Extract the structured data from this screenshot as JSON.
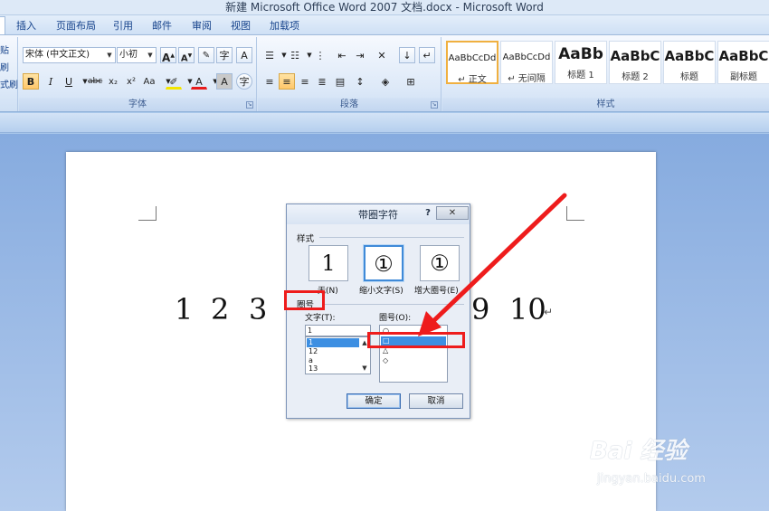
{
  "window": {
    "title": "新建 Microsoft Office Word 2007 文档.docx - Microsoft Word"
  },
  "tabs": [
    "插入",
    "页面布局",
    "引用",
    "邮件",
    "审阅",
    "视图",
    "加载项"
  ],
  "ribbon": {
    "font": {
      "name": "宋体 (中文正文)",
      "size": "小初",
      "group_label": "字体",
      "bold": "B",
      "italic": "I",
      "underline": "U",
      "strike": "abc",
      "subscript": "x₂",
      "superscript": "x²",
      "change_case": "Aa",
      "grow": "A",
      "shrink": "A",
      "phonetic": "字",
      "border_char": "A",
      "enclosed_char": "字"
    },
    "paragraph": {
      "group_label": "段落"
    },
    "styles": {
      "group_label": "样式",
      "items": [
        {
          "sample": "AaBbCcDd",
          "name": "↵ 正文"
        },
        {
          "sample": "AaBbCcDd",
          "name": "↵ 无间隔"
        },
        {
          "sample": "AaBb",
          "name": "标题 1"
        },
        {
          "sample": "AaBbC",
          "name": "标题 2"
        },
        {
          "sample": "AaBbC",
          "name": "标题"
        },
        {
          "sample": "AaBbC",
          "name": "副标题"
        }
      ]
    },
    "left_cut": {
      "a": "贴",
      "b": "刷",
      "c": "式刷"
    }
  },
  "document": {
    "numbers": [
      "1",
      "2",
      "3",
      "9",
      "10"
    ],
    "para_mark": "↵"
  },
  "dialog": {
    "title": "带圈字符",
    "help": "?",
    "close": "✕",
    "style_label": "样式",
    "style_options": [
      {
        "glyph": "1",
        "caption": "无(N)"
      },
      {
        "glyph": "①",
        "caption": "缩小文字(S)"
      },
      {
        "glyph": "①",
        "caption": "增大圈号(E)"
      }
    ],
    "symbol_label": "圈号",
    "text_label": "文字(T):",
    "text_value": "1",
    "text_items": [
      "1",
      "12",
      "a",
      "13"
    ],
    "circle_label": "圈号(O):",
    "circle_items": [
      "○",
      "□",
      "△",
      "◇"
    ],
    "ok": "确定",
    "cancel": "取消"
  },
  "watermark": {
    "brand": "Bai 经验",
    "url": "jingyan.baidu.com"
  },
  "colors": {
    "annotation_red": "#ee1c1c",
    "selection_blue": "#3d8fe2"
  }
}
